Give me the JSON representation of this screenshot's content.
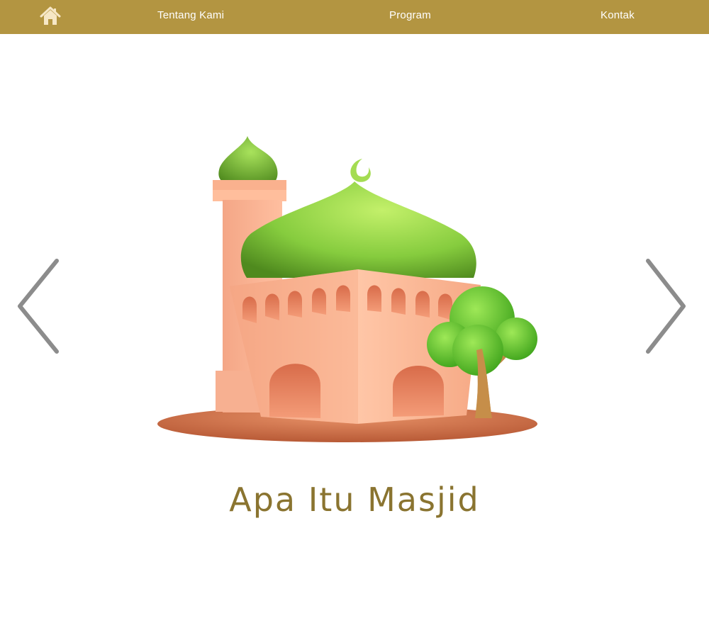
{
  "nav": {
    "home_icon": "home-icon",
    "items": [
      "Tentang Kami",
      "Program",
      "Kontak"
    ]
  },
  "slider": {
    "title": "Apa Itu Masjid",
    "prev_icon": "chevron-left-icon",
    "next_icon": "chevron-right-icon"
  },
  "colors": {
    "navbar": "#b39541",
    "title": "#8a7430",
    "arrow": "#8c8c8c",
    "dome_green": "#8fd94e",
    "wall_peach": "#f7b395",
    "ground": "#d27a55"
  }
}
